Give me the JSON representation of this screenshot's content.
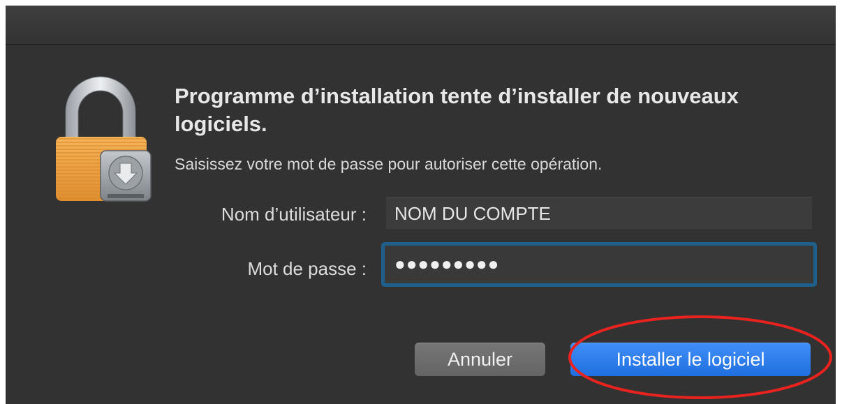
{
  "dialog": {
    "heading": "Programme d’installation tente d’installer de nouveaux logiciels.",
    "message": "Saisissez votre mot de passe pour autoriser cette opération.",
    "icon": "lock-with-installer-disk-icon"
  },
  "form": {
    "username_label": "Nom d’utilisateur :",
    "username_value": "NOM DU COMPTE",
    "password_label": "Mot de passe :",
    "password_value": "●●●●●●●●●"
  },
  "buttons": {
    "cancel_label": "Annuler",
    "install_label": "Installer le logiciel"
  },
  "colors": {
    "dialog_background": "#323232",
    "focus_ring": "#1f5f8b",
    "primary_button": "#2a7cf0",
    "annotation_circle": "#e8231f",
    "lock_body": "#f0a448"
  }
}
